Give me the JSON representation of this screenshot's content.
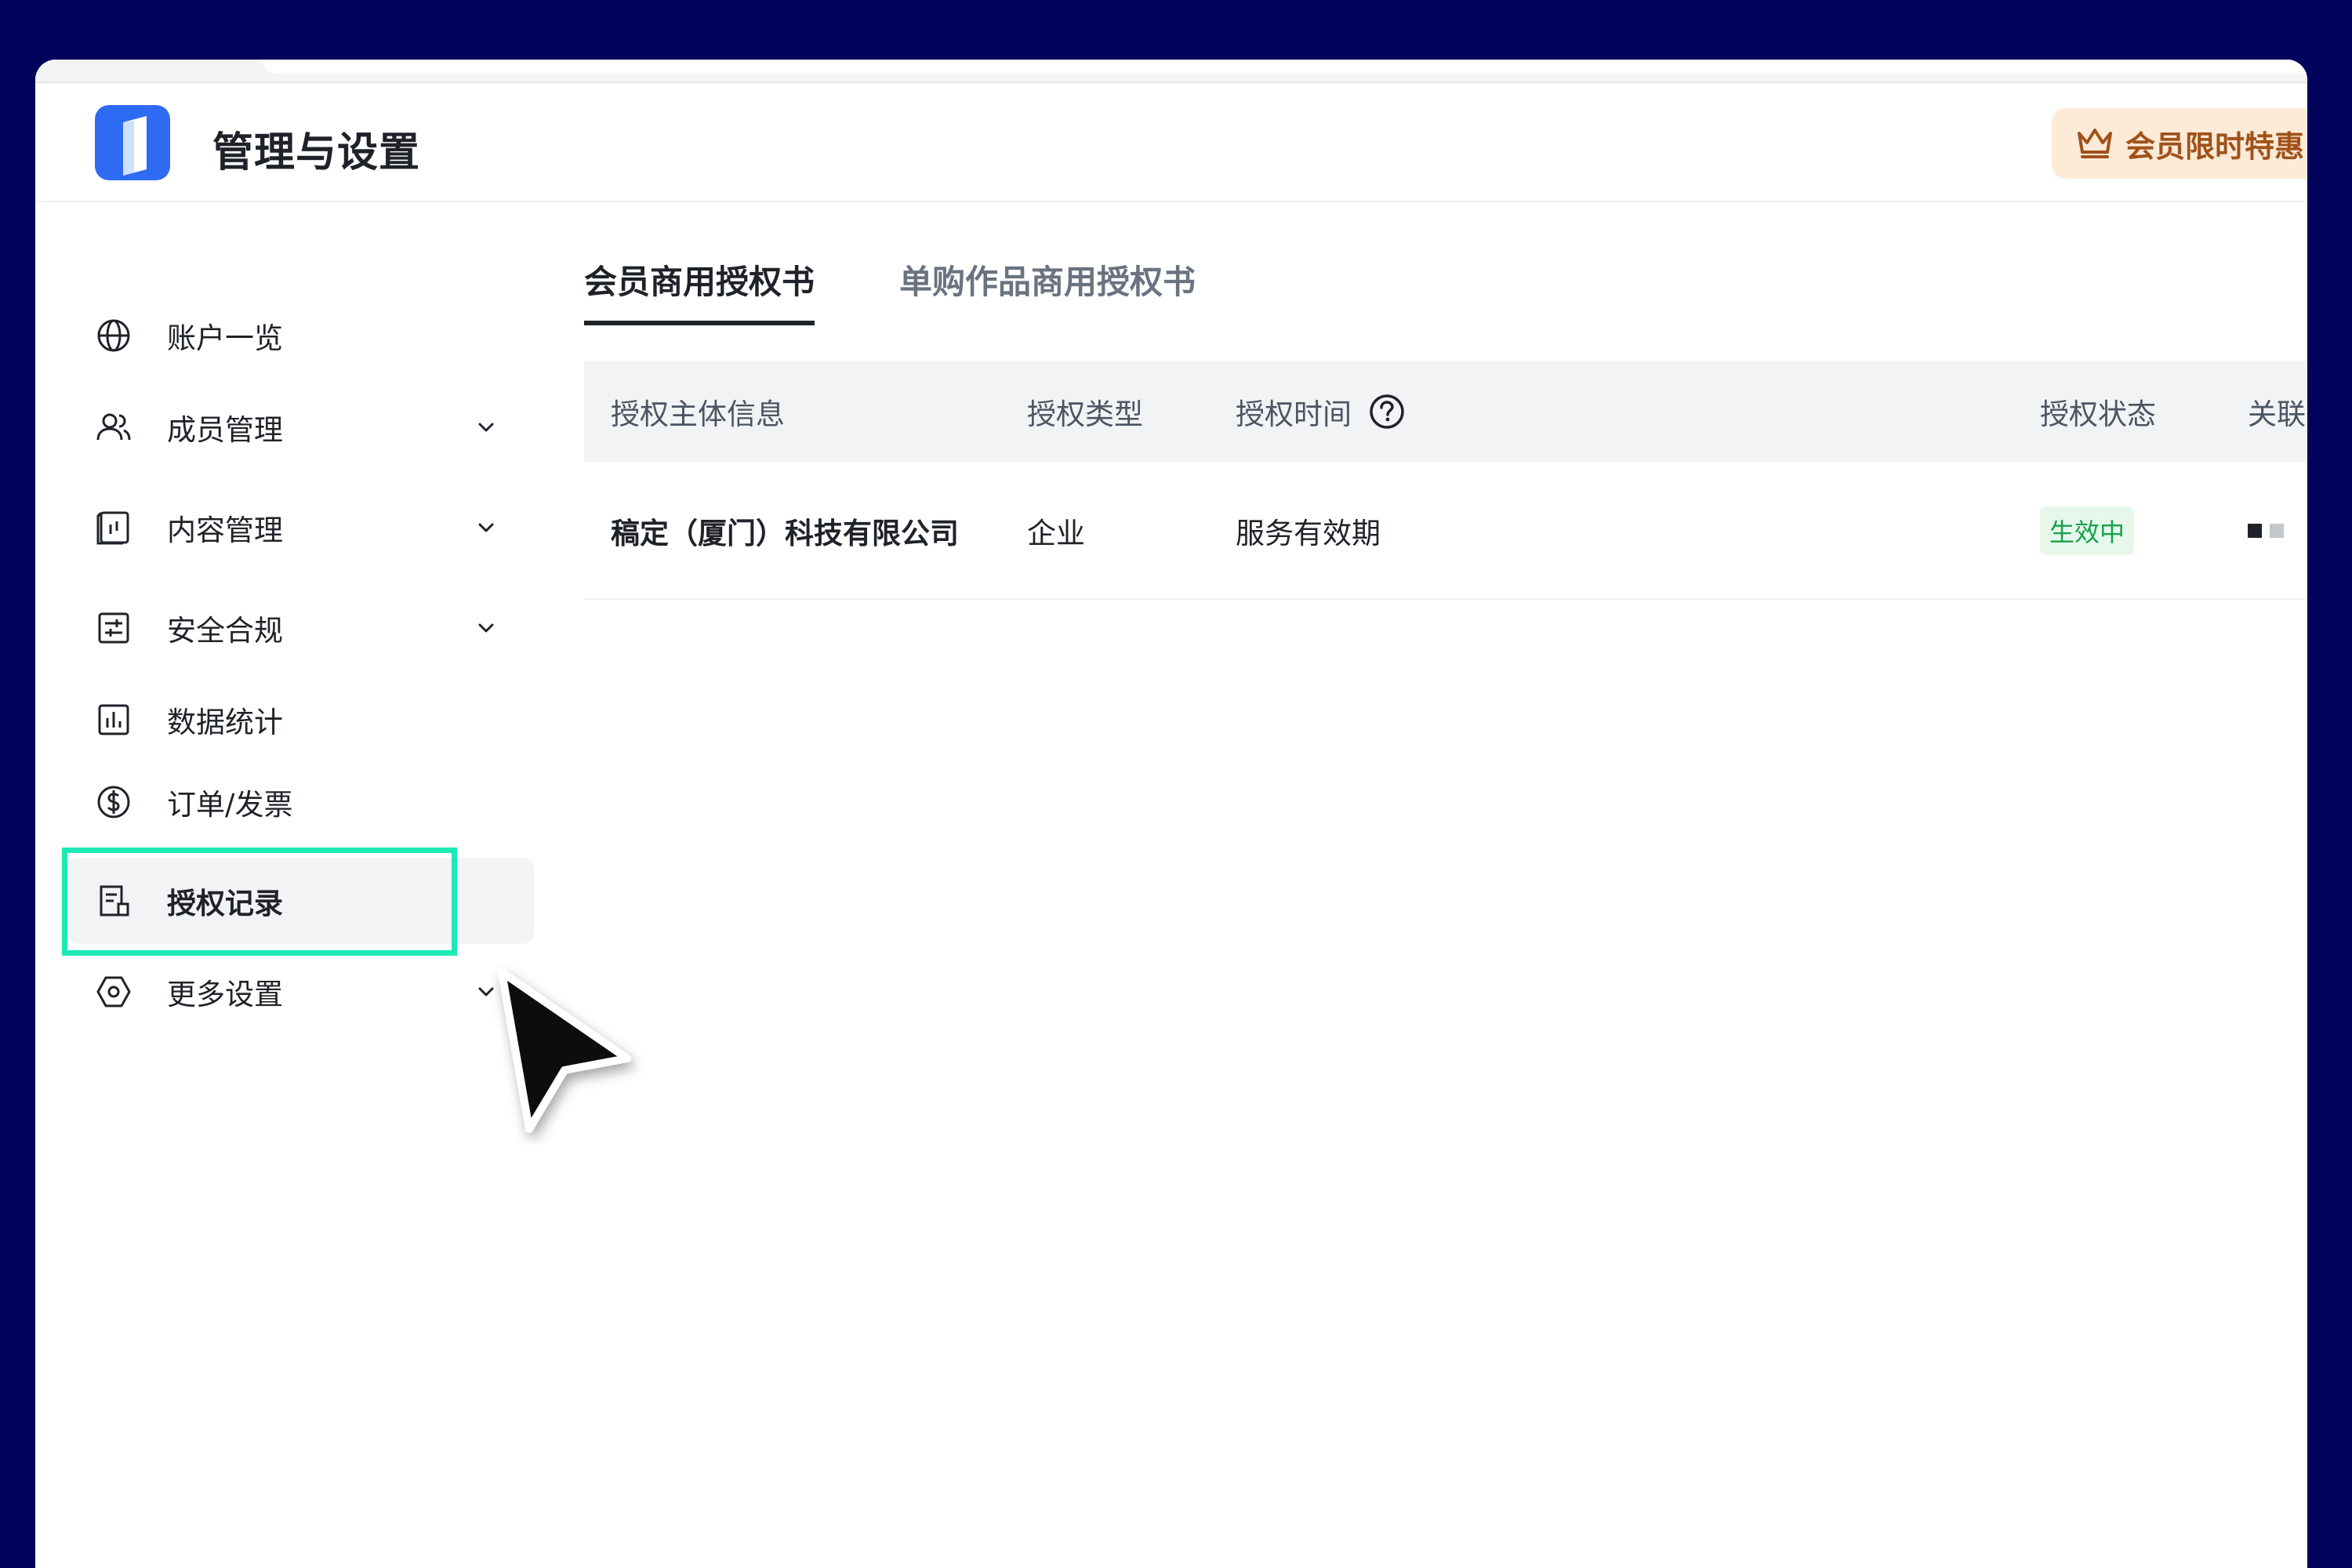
{
  "app": {
    "title": "管理与设置",
    "promo_label": "会员限时特惠"
  },
  "sidebar": {
    "items": [
      {
        "label": "账户一览",
        "icon": "globe-icon",
        "has_chevron": false
      },
      {
        "label": "成员管理",
        "icon": "users-icon",
        "has_chevron": true
      },
      {
        "label": "内容管理",
        "icon": "content-icon",
        "has_chevron": true
      },
      {
        "label": "安全合规",
        "icon": "security-icon",
        "has_chevron": true
      },
      {
        "label": "数据统计",
        "icon": "bar-chart-icon",
        "has_chevron": false
      },
      {
        "label": "订单/发票",
        "icon": "dollar-icon",
        "has_chevron": false
      },
      {
        "label": "授权记录",
        "icon": "document-icon",
        "has_chevron": false,
        "active": true
      },
      {
        "label": "更多设置",
        "icon": "hexagon-settings-icon",
        "has_chevron": true
      }
    ]
  },
  "tabs": [
    {
      "label": "会员商用授权书",
      "active": true
    },
    {
      "label": "单购作品商用授权书",
      "active": false
    }
  ],
  "table": {
    "columns": [
      "授权主体信息",
      "授权类型",
      "授权时间",
      "授权状态",
      "关联"
    ],
    "rows": [
      {
        "subject": "稿定（厦门）科技有限公司",
        "type": "企业",
        "time": "服务有效期",
        "status": "生效中"
      }
    ]
  },
  "colors": {
    "background": "#02035a",
    "highlight": "#1de9b6",
    "status_green": "#16a34a",
    "promo_bg": "#fdebd8",
    "promo_text": "#a0521b",
    "logo_blue": "#2f6bf2"
  }
}
